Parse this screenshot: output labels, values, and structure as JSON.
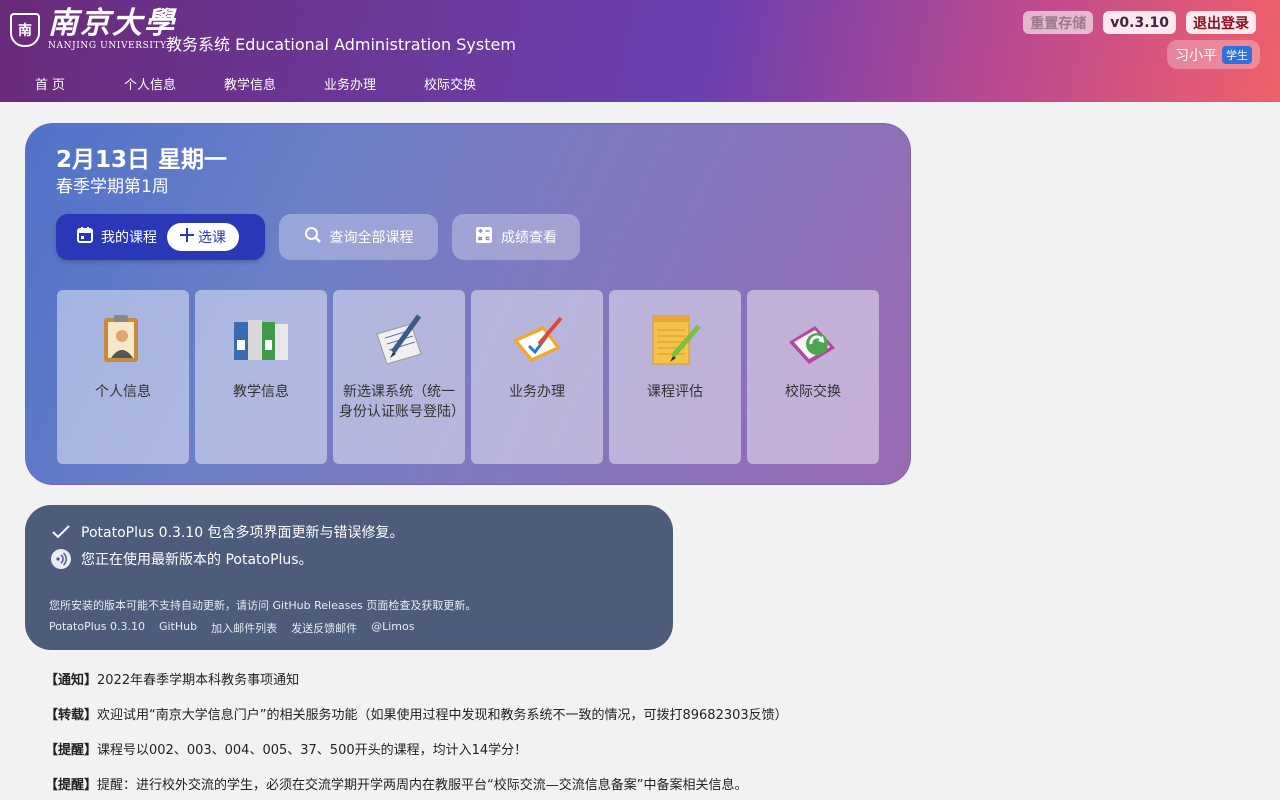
{
  "header": {
    "logo_emblem": "南",
    "logo_cn": "南京大學",
    "logo_en": "NANJING UNIVERSITY",
    "system_title": "教务系统 Educational Administration System",
    "nav": [
      "首 页",
      "个人信息",
      "教学信息",
      "业务办理",
      "校际交换"
    ],
    "reset_label": "重置存储",
    "version_label": "v0.3.10",
    "logout_label": "退出登录",
    "user_name": "习小平",
    "user_role": "学生"
  },
  "hero": {
    "date": "2月13日 星期一",
    "week": "春季学期第1周",
    "my_courses": "我的课程",
    "select_course": "选课",
    "query_all": "查询全部课程",
    "grades": "成绩查看",
    "tiles": [
      {
        "label": "个人信息",
        "icon": "personal-card-icon"
      },
      {
        "label": "教学信息",
        "icon": "binders-icon"
      },
      {
        "label": "新选课系统（统一身份认证账号登陆）",
        "icon": "pen-paper-icon"
      },
      {
        "label": "业务办理",
        "icon": "clipboard-icon"
      },
      {
        "label": "课程评估",
        "icon": "notepad-icon"
      },
      {
        "label": "校际交换",
        "icon": "exchange-icon"
      }
    ]
  },
  "update": {
    "line1": "PotatoPlus 0.3.10 包含多项界面更新与错误修复。",
    "line2": "您正在使用最新版本的 PotatoPlus。",
    "note": "您所安装的版本可能不支持自动更新，请访问 GitHub Releases 页面检查及获取更新。",
    "links": [
      "PotatoPlus 0.3.10",
      "GitHub",
      "加入邮件列表",
      "发送反馈邮件",
      "@Limos"
    ]
  },
  "notices": [
    {
      "tag": "【通知】",
      "text": "2022年春季学期本科教务事项通知"
    },
    {
      "tag": "【转载】",
      "text": "欢迎试用“南京大学信息门户”的相关服务功能（如果使用过程中发现和教务系统不一致的情况，可拨打89682303反馈）"
    },
    {
      "tag": "【提醒】",
      "text": "课程号以002、003、004、005、37、500开头的课程，均计入14学分！"
    },
    {
      "tag": "【提醒】",
      "text": "提醒：进行校外交流的学生，必须在交流学期开学两周内在教服平台“校际交流—交流信息备案”中备案相关信息。"
    }
  ],
  "colors": {
    "header_start": "#6a2a7a",
    "header_end": "#f0606a",
    "primary_button": "#2a38b8",
    "update_card": "#4c5c7a",
    "user_badge": "#2f6fe0"
  }
}
